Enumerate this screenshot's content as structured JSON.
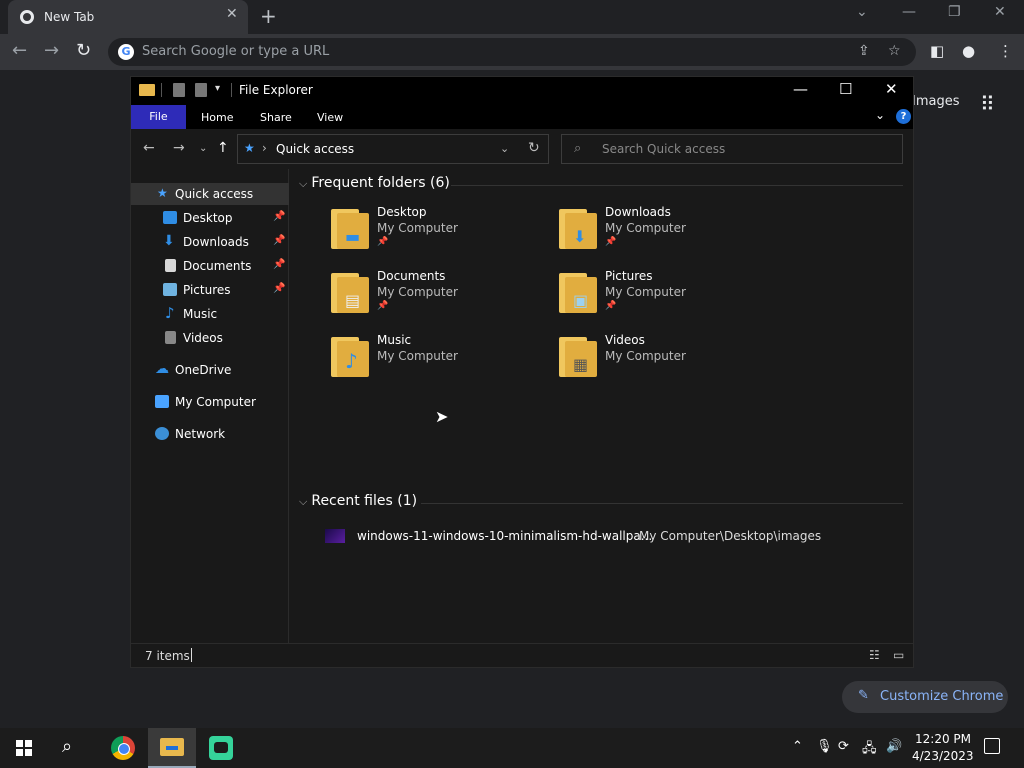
{
  "browser": {
    "tab_title": "New Tab",
    "omnibox_placeholder": "Search Google or type a URL",
    "images_link": "Images",
    "customize_label": "Customize Chrome"
  },
  "explorer": {
    "title": "File Explorer",
    "ribbon": {
      "file": "File",
      "home": "Home",
      "share": "Share",
      "view": "View"
    },
    "address": "Quick access",
    "search_placeholder": "Search Quick access",
    "nav": [
      {
        "label": "Quick access",
        "icon": "star-icon",
        "color": "#4aa3ff"
      },
      {
        "label": "Desktop",
        "icon": "desktop-icon",
        "color": "#2f8de4",
        "pinned": true
      },
      {
        "label": "Downloads",
        "icon": "download-icon",
        "color": "#2f8de4",
        "pinned": true
      },
      {
        "label": "Documents",
        "icon": "document-icon",
        "color": "#d8d8d8",
        "pinned": true
      },
      {
        "label": "Pictures",
        "icon": "picture-icon",
        "color": "#6fb3e0",
        "pinned": true
      },
      {
        "label": "Music",
        "icon": "music-icon",
        "color": "#2f8de4"
      },
      {
        "label": "Videos",
        "icon": "video-icon",
        "color": "#888888"
      },
      {
        "label": "OneDrive",
        "icon": "cloud-icon",
        "color": "#2f8de4"
      },
      {
        "label": "My Computer",
        "icon": "computer-icon",
        "color": "#4aa3ff"
      },
      {
        "label": "Network",
        "icon": "network-icon",
        "color": "#4aa3ff"
      }
    ],
    "frequent_header": "Frequent folders (6)",
    "folders": [
      {
        "name": "Desktop",
        "location": "My Computer",
        "pinned": true
      },
      {
        "name": "Downloads",
        "location": "My Computer",
        "pinned": true
      },
      {
        "name": "Documents",
        "location": "My Computer",
        "pinned": true
      },
      {
        "name": "Pictures",
        "location": "My Computer",
        "pinned": true
      },
      {
        "name": "Music",
        "location": "My Computer",
        "pinned": false
      },
      {
        "name": "Videos",
        "location": "My Computer",
        "pinned": false
      }
    ],
    "recent_header": "Recent files (1)",
    "recent": [
      {
        "name": "windows-11-windows-10-minimalism-hd-wallpa...",
        "path": "My Computer\\Desktop\\images"
      }
    ],
    "status": "7 items"
  },
  "taskbar": {
    "time": "12:20 PM",
    "date": "4/23/2023"
  },
  "colors": {
    "ribbon_file": "#2e2bb8",
    "accent_blue": "#8ab4f8",
    "folder_yellow": "#e1ad3f"
  }
}
